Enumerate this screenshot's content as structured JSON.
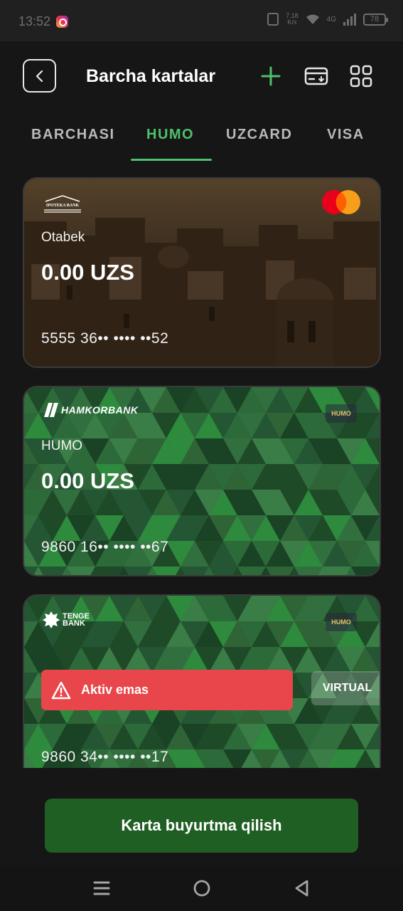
{
  "status_bar": {
    "time": "13:52",
    "app_icon": "instagram-icon",
    "speed": "7.18\nK/s",
    "network": "4G",
    "battery": "78"
  },
  "header": {
    "title": "Barcha kartalar",
    "back_icon": "chevron-left-icon",
    "add_icon": "plus-icon",
    "card_icon": "card-download-icon",
    "grid_icon": "grid-icon"
  },
  "tabs": [
    {
      "label": "BARCHASI",
      "active": false
    },
    {
      "label": "HUMO",
      "active": true
    },
    {
      "label": "UZCARD",
      "active": false
    },
    {
      "label": "VISA",
      "active": false
    }
  ],
  "cards": [
    {
      "bank": "IPOTEKA BANK",
      "holder": "Otabek",
      "balance": "0.00 UZS",
      "number": "5555 36•• •••• ••52",
      "network": "mastercard"
    },
    {
      "bank": "HAMKORBANK",
      "holder": "HUMO",
      "balance": "0.00 UZS",
      "number": "9860 16•• •••• ••67",
      "network": "HUMO"
    },
    {
      "bank": "TENGE BANK",
      "status": "Aktiv emas",
      "tag": "VIRTUAL",
      "number": "9860 34•• •••• ••17",
      "network": "HUMO"
    }
  ],
  "order_button": "Karta buyurtma qilish",
  "colors": {
    "accent": "#4fc06b",
    "button": "#1f5f23",
    "alert": "#e8464a",
    "background": "#161616"
  }
}
